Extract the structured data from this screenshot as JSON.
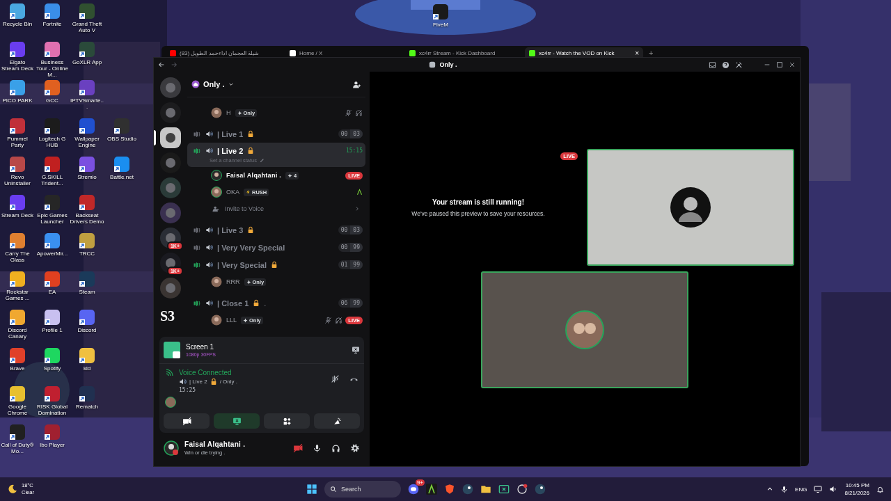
{
  "desktop": {
    "columns": [
      [
        {
          "label": "Recycle Bin",
          "color": "#4aa8e0"
        },
        {
          "label": "Elgato Stream Deck",
          "color": "#6a3df0"
        },
        {
          "label": "PICO PARK",
          "color": "#3aa0e8"
        },
        {
          "label": "Pummel Party",
          "color": "#c0303a"
        },
        {
          "label": "Revo Uninstaller",
          "color": "#b84848"
        },
        {
          "label": "Stream Deck",
          "color": "#6a3df0"
        },
        {
          "label": "Carry The Glass",
          "color": "#e08030"
        },
        {
          "label": "Rockstar Games ...",
          "color": "#f0b020"
        },
        {
          "label": "Discord Canary",
          "color": "#f0a830"
        },
        {
          "label": "Brave",
          "color": "#e0402a"
        },
        {
          "label": "Google Chrome",
          "color": "#e8c030"
        },
        {
          "label": "Call of Duty® Mo...",
          "color": "#202020"
        }
      ],
      [
        {
          "label": "Fortnite",
          "color": "#3a8ee8"
        },
        {
          "label": "Business Tour - Online M...",
          "color": "#e070b0"
        },
        {
          "label": "GCC",
          "color": "#e06020"
        },
        {
          "label": "Logitech G HUB",
          "color": "#1c1c1c"
        },
        {
          "label": "G.SKILL Trident...",
          "color": "#c02020"
        },
        {
          "label": "Epic Games Launcher",
          "color": "#262626"
        },
        {
          "label": "ApowerMir...",
          "color": "#3a90f0"
        },
        {
          "label": "EA",
          "color": "#e04020"
        },
        {
          "label": "Profile 1",
          "color": "#c8c0f0"
        },
        {
          "label": "Spotify",
          "color": "#1ed760"
        },
        {
          "label": "RISK Global Domination",
          "color": "#c02030"
        },
        {
          "label": "Ibo Player",
          "color": "#a02030"
        }
      ],
      [
        {
          "label": "Grand Theft Auto V",
          "color": "#305030"
        },
        {
          "label": "GoXLR App",
          "color": "#2a4a3a"
        },
        {
          "label": "IPTVSmarte...",
          "color": "#6a40c0"
        },
        {
          "label": "Wallpaper Engine",
          "color": "#2050d0"
        },
        {
          "label": "Stremio",
          "color": "#7a50e0"
        },
        {
          "label": "Backseat Drivers Demo",
          "color": "#c02828"
        },
        {
          "label": "TRCC",
          "color": "#c0a040"
        },
        {
          "label": "Steam",
          "color": "#1a3a5a"
        },
        {
          "label": "Discord",
          "color": "#5865f2"
        },
        {
          "label": "kld",
          "color": "#f0c040"
        },
        {
          "label": "Rematch",
          "color": "#203050"
        }
      ],
      [
        {
          "label": "OBS Studio",
          "color": "#303030"
        },
        {
          "label": "Battle.net",
          "color": "#1a8ef0"
        }
      ]
    ],
    "floating_icon": {
      "label": "FiveM",
      "color": "#1a1a1a"
    }
  },
  "browser": {
    "tabs": [
      {
        "label": "(83) شيلة العجمان اداءحمد الطويل",
        "selected": false,
        "color": "#ff0000"
      },
      {
        "label": "Home / X",
        "selected": false,
        "color": "#ffffff"
      },
      {
        "label": "xc4rr Stream - Kick Dashboard",
        "selected": false,
        "color": "#53fc18"
      },
      {
        "label": "xc4rr - Watch the VOD on Kick",
        "selected": true,
        "color": "#53fc18"
      }
    ],
    "close_tab": "×",
    "new_tab": "+"
  },
  "discord": {
    "title": "Only .",
    "servers": [
      {
        "selected": false
      },
      {
        "selected": false
      },
      {
        "selected": true
      },
      {
        "selected": false
      },
      {
        "selected": false
      },
      {
        "selected": false
      },
      {
        "selected": false,
        "badge": "1K+"
      },
      {
        "selected": false,
        "badge": "1K+"
      },
      {
        "selected": false
      },
      {
        "selected": false,
        "label": "S3"
      }
    ],
    "server_name": "Only .",
    "channels": [
      {
        "kind": "member",
        "name": "H",
        "tag": {
          "kind": "sparkle",
          "label": "Only"
        },
        "self": false,
        "muted": true,
        "deafened": true,
        "activity": false
      },
      {
        "kind": "channel",
        "name": "| Live 1",
        "locked": true,
        "active": false,
        "selected": false,
        "counts": [
          "00",
          "03"
        ]
      },
      {
        "kind": "channel",
        "name": "| Live 2",
        "locked": true,
        "active": true,
        "selected": true,
        "timer": "15:15",
        "status": "Set a channel status"
      },
      {
        "kind": "member",
        "name": "Faisal Alqahtani .",
        "tag": {
          "kind": "sparkle",
          "label": "4"
        },
        "self": true,
        "muted": false,
        "deafened": false,
        "activity": false,
        "live": "LIVE"
      },
      {
        "kind": "member",
        "name": "OKA",
        "tag": {
          "kind": "bolt",
          "label": "RUSH"
        },
        "self": false,
        "muted": false,
        "deafened": false,
        "activity": true
      },
      {
        "kind": "invite",
        "name": "Invite to Voice"
      },
      {
        "kind": "channel",
        "name": "| Live 3",
        "locked": true,
        "active": false,
        "selected": false,
        "counts": [
          "00",
          "03"
        ]
      },
      {
        "kind": "channel",
        "name": "| Very Very Special",
        "locked": false,
        "active": false,
        "selected": false,
        "counts": [
          "00",
          "99"
        ]
      },
      {
        "kind": "channel",
        "name": "| Very Special",
        "locked": true,
        "active": true,
        "selected": false,
        "counts": [
          "01",
          "99"
        ]
      },
      {
        "kind": "member",
        "name": "RRR",
        "tag": {
          "kind": "sparkle",
          "label": "Only"
        },
        "self": false,
        "muted": false,
        "deafened": false,
        "activity": false
      },
      {
        "kind": "channel",
        "name": "| Close 1",
        "locked": true,
        "suffix": ".",
        "active": true,
        "selected": false,
        "counts": [
          "06",
          "99"
        ]
      },
      {
        "kind": "member",
        "name": "LLL",
        "tag": {
          "kind": "sparkle",
          "label": "Only"
        },
        "self": false,
        "muted": true,
        "deafened": true,
        "activity": false,
        "live": "LIVE"
      }
    ],
    "stream": {
      "name": "Screen 1",
      "quality": "1080p 30FPS"
    },
    "voice": {
      "state": "Voice Connected",
      "channel": "| Live 2",
      "server": "/ Only .",
      "elapsed": "15:25"
    },
    "user": {
      "name": "Faisal Alqahtani .",
      "status": "Win or die trying ."
    },
    "stage": {
      "live": "LIVE",
      "title": "Your stream is still running!",
      "subtitle": "We've paused this preview to save your resources."
    }
  },
  "taskbar": {
    "temperature": "18°C",
    "weather": "Clear",
    "search": "Search",
    "badge": "9+",
    "language": "ENG",
    "time": "10:45 PM",
    "date": "8/21/2026"
  }
}
